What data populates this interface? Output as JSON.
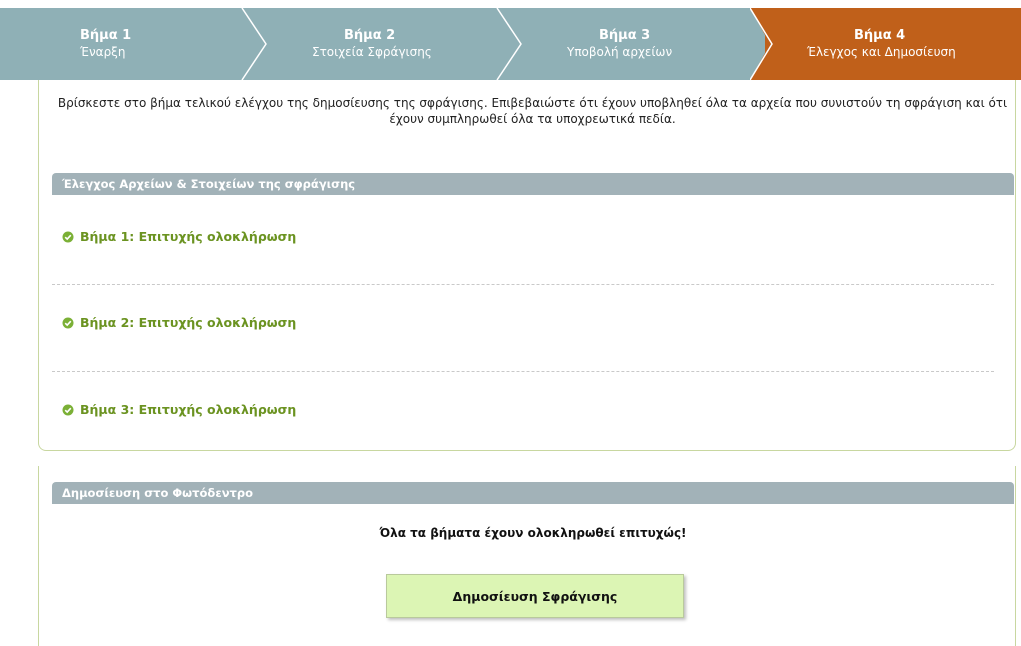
{
  "steps": [
    {
      "title": "Βήμα 1",
      "subtitle": "Έναρξη",
      "active": false
    },
    {
      "title": "Βήμα 2",
      "subtitle": "Στοιχεία Σφράγισης",
      "active": false
    },
    {
      "title": "Βήμα 3",
      "subtitle": "Υποβολή αρχείων",
      "active": false
    },
    {
      "title": "Βήμα 4",
      "subtitle": "Έλεγχος και Δημοσίευση",
      "active": true
    }
  ],
  "intro_text": "Βρίσκεστε στο βήμα τελικού ελέγχου της δημοσίευσης της σφράγισης. Επιβεβαιώστε ότι έχουν υποβληθεί όλα τα αρχεία που συνιστούν τη σφράγιση και ότι έχουν συμπληρωθεί όλα τα υποχρεωτικά πεδία.",
  "check_section": {
    "header": "Έλεγχος Αρχείων & Στοιχείων της σφράγισης",
    "items": [
      "Βήμα 1: Επιτυχής ολοκλήρωση",
      "Βήμα 2: Επιτυχής ολοκλήρωση",
      "Βήμα 3: Επιτυχής ολοκλήρωση"
    ]
  },
  "publish_section": {
    "header": "Δημοσίευση στο Φωτόδεντρο",
    "message": "Όλα τα βήματα έχουν ολοκληρωθεί επιτυχώς!",
    "button_label": "Δημοσίευση Σφράγισης"
  },
  "colors": {
    "steps_bg": "#8fb0b6",
    "active_step_bg": "#c0601a",
    "section_header_bg": "#a2b2b8",
    "success_green": "#6b9321",
    "button_bg": "#dcf5b4"
  },
  "icons": {
    "check": "check-circle-icon"
  }
}
